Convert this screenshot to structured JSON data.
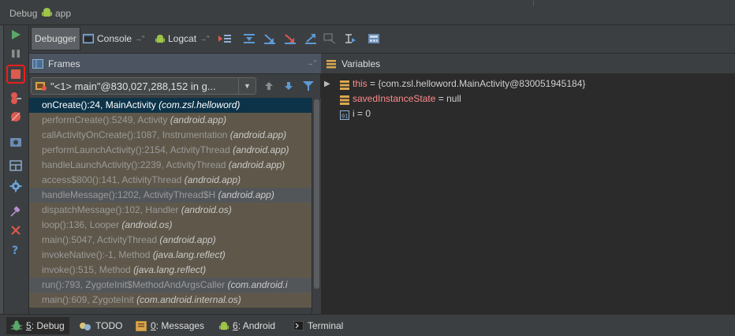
{
  "titlebar": {
    "left": "Debug",
    "right": "app"
  },
  "toolbar": {
    "tabs": [
      {
        "label": "Debugger"
      },
      {
        "label": "Console"
      },
      {
        "label": "Logcat"
      }
    ],
    "pin_glyph": "→\""
  },
  "frames": {
    "title": "Frames",
    "pin_glyph": "→\"",
    "thread_select": "\"<1> main\"@830,027,288,152 in g...",
    "items": [
      {
        "method": "onCreate():24, MainActivity ",
        "pkg": "(com.zsl.helloword)"
      },
      {
        "method": "performCreate():5249, Activity ",
        "pkg": "(android.app)"
      },
      {
        "method": "callActivityOnCreate():1087, Instrumentation ",
        "pkg": "(android.app)"
      },
      {
        "method": "performLaunchActivity():2154, ActivityThread ",
        "pkg": "(android.app)"
      },
      {
        "method": "handleLaunchActivity():2239, ActivityThread ",
        "pkg": "(android.app)"
      },
      {
        "method": "access$800():141, ActivityThread ",
        "pkg": "(android.app)"
      },
      {
        "method": "handleMessage():1202, ActivityThread$H ",
        "pkg": "(android.app)"
      },
      {
        "method": "dispatchMessage():102, Handler ",
        "pkg": "(android.os)"
      },
      {
        "method": "loop():136, Looper ",
        "pkg": "(android.os)"
      },
      {
        "method": "main():5047, ActivityThread ",
        "pkg": "(android.app)"
      },
      {
        "method": "invokeNative():-1, Method ",
        "pkg": "(java.lang.reflect)"
      },
      {
        "method": "invoke():515, Method ",
        "pkg": "(java.lang.reflect)"
      },
      {
        "method": "run():793, ZygoteInit$MethodAndArgsCaller ",
        "pkg": "(com.android.i"
      },
      {
        "method": "main():609, ZygoteInit ",
        "pkg": "(com.android.internal.os)"
      }
    ]
  },
  "variables": {
    "title": "Variables",
    "rows": [
      {
        "name": "this",
        "op": " = ",
        "value": "{com.zsl.helloword.MainActivity@830051945184}"
      },
      {
        "name": "savedInstanceState",
        "op": " = ",
        "value": "null"
      },
      {
        "name": "i",
        "op": " = ",
        "value": "0"
      }
    ]
  },
  "bottom": {
    "tabs": [
      {
        "num": "5",
        "label": ": Debug"
      },
      {
        "num": "",
        "label": "TODO"
      },
      {
        "num": "0",
        "label": ": Messages"
      },
      {
        "num": "6",
        "label": ": Android"
      },
      {
        "num": "",
        "label": "Terminal"
      }
    ]
  },
  "colors": {
    "selected_frame": "#0d3349",
    "library_frame": "#5f584a",
    "stop_highlight": "#ee1c1c",
    "variable_name": "#ff8a8a"
  }
}
